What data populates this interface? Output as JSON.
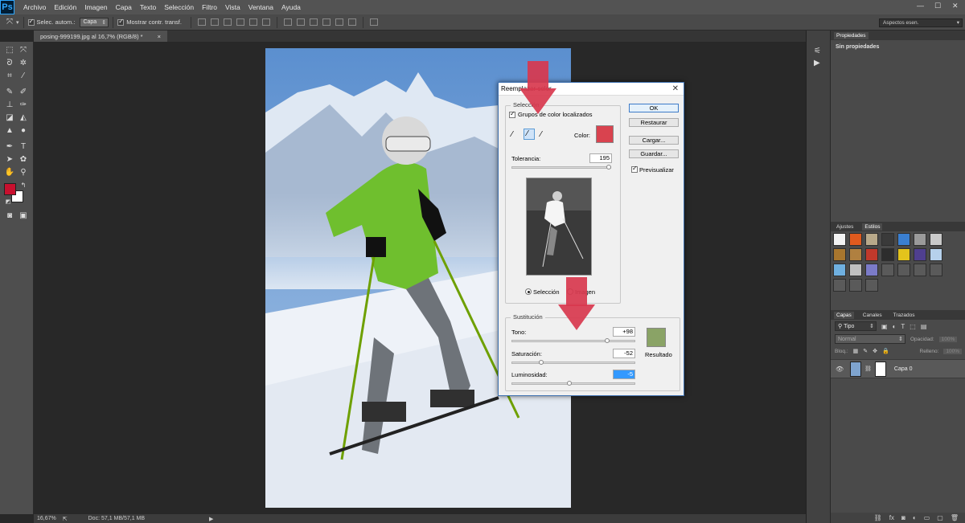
{
  "app": {
    "logo": "Ps"
  },
  "menu": [
    "Archivo",
    "Edición",
    "Imagen",
    "Capa",
    "Texto",
    "Selección",
    "Filtro",
    "Vista",
    "Ventana",
    "Ayuda"
  ],
  "options_bar": {
    "auto_select_label": "Selec. autom.:",
    "auto_select_value": "Capa",
    "show_transform_label": "Mostrar contr. transf."
  },
  "workspace": {
    "value": "Aspectos esen."
  },
  "document": {
    "tab_title": "posing-999199.jpg al 16,7% (RGB/8) *",
    "close": "×"
  },
  "status": {
    "zoom": "16,67%",
    "doc": "Doc: 57,1 MB/57,1 MB"
  },
  "properties_panel": {
    "tab": "Propiedades",
    "content": "Sin propiedades"
  },
  "styles_panel": {
    "tabs": [
      "Ajustes",
      "Estilos"
    ]
  },
  "layers_panel": {
    "tabs": [
      "Capas",
      "Canales",
      "Trazados"
    ],
    "filter": "Tipo",
    "blend_mode": "Normal",
    "opacity_label": "Opacidad:",
    "opacity_value": "100%",
    "lock_label": "Bloq.:",
    "fill_label": "Relleno:",
    "fill_value": "100%",
    "layer_name": "Capa 0"
  },
  "dialog": {
    "title": "Reemplazar color",
    "close": "✕",
    "selection_legend": "Selección",
    "localized_label": "Grupos de color localizados",
    "color_label": "Color:",
    "tolerance_label": "Tolerancia:",
    "tolerance_value": "195",
    "radio_selection": "Selección",
    "radio_image": "Imagen",
    "replacement_legend": "Sustitución",
    "hue_label": "Tono:",
    "hue_value": "+98",
    "saturation_label": "Saturación:",
    "saturation_value": "-52",
    "lightness_label": "Luminosidad:",
    "lightness_value": "-5",
    "result_label": "Resultado",
    "buttons": {
      "ok": "OK",
      "reset": "Restaurar",
      "load": "Cargar...",
      "save": "Guardar..."
    },
    "preview_label": "Previsualizar",
    "sample_color": "#d9434f",
    "result_color": "#8aa366",
    "tolerance_fraction": 0.975,
    "hue_fraction": 0.77,
    "saturation_fraction": 0.24,
    "lightness_fraction": 0.47
  },
  "colors": {
    "foreground": "#c8102e",
    "background": "#ffffff",
    "annotation_arrow": "#d8384e"
  }
}
